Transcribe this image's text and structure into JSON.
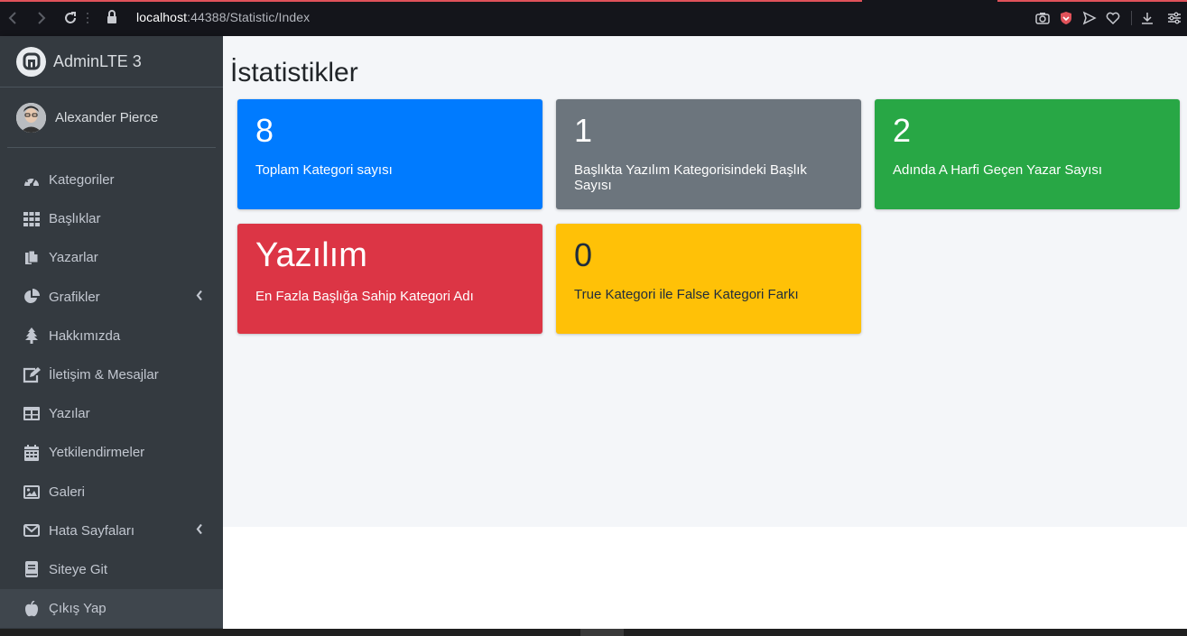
{
  "browser": {
    "url_host": "localhost",
    "url_rest": ":44388/Statistic/Index"
  },
  "brand": {
    "name": "AdminLTE 3"
  },
  "user": {
    "name": "Alexander Pierce"
  },
  "sidebar": {
    "items": [
      {
        "label": "Kategoriler",
        "icon": "dashboard-icon"
      },
      {
        "label": "Başlıklar",
        "icon": "grid-icon"
      },
      {
        "label": "Yazarlar",
        "icon": "copy-icon"
      },
      {
        "label": "Grafikler",
        "icon": "pie-chart-icon",
        "has_submenu": true
      },
      {
        "label": "Hakkımızda",
        "icon": "tree-icon"
      },
      {
        "label": "İletişim & Mesajlar",
        "icon": "edit-icon"
      },
      {
        "label": "Yazılar",
        "icon": "table-icon"
      },
      {
        "label": "Yetkilendirmeler",
        "icon": "calendar-icon"
      },
      {
        "label": "Galeri",
        "icon": "image-icon"
      },
      {
        "label": "Hata Sayfaları",
        "icon": "envelope-icon",
        "has_submenu": true
      },
      {
        "label": "Siteye Git",
        "icon": "book-icon"
      },
      {
        "label": "Çıkış Yap",
        "icon": "apple-icon"
      }
    ]
  },
  "main": {
    "title": "İstatistikler",
    "boxes": [
      {
        "value": "8",
        "label": "Toplam Kategori sayısı",
        "color": "#007bff",
        "text_color": "#ffffff"
      },
      {
        "value": "1",
        "label": "Başlıkta Yazılım Kategorisindeki Başlık Sayısı",
        "color": "#6c757d",
        "text_color": "#ffffff"
      },
      {
        "value": "2",
        "label": "Adında A Harfi Geçen Yazar Sayısı",
        "color": "#28a745",
        "text_color": "#ffffff"
      },
      {
        "value": "Yazılım",
        "label": "En Fazla Başlığa Sahip Kategori Adı",
        "color": "#dc3545",
        "text_color": "#ffffff"
      },
      {
        "value": "0",
        "label": "True Kategori ile False Kategori Farkı",
        "color": "#ffc107",
        "text_color": "#1f2d3d"
      }
    ]
  }
}
